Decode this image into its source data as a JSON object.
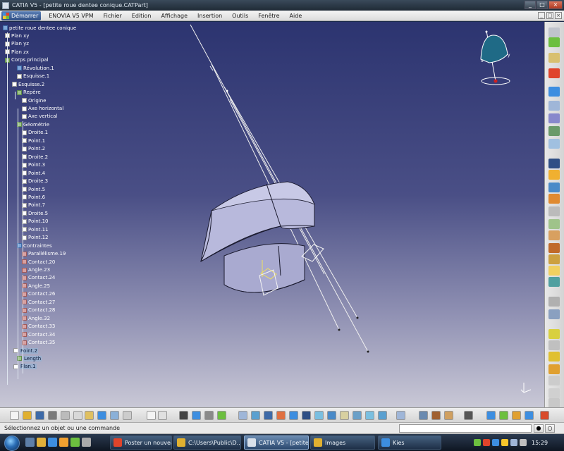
{
  "window": {
    "title": "CATIA V5 - [petite roue dentee conique.CATPart]",
    "controls": [
      "_",
      "□",
      "×"
    ]
  },
  "menu": {
    "start_label": "Démarrer",
    "items": [
      "ENOVIA V5 VPM",
      "Fichier",
      "Edition",
      "Affichage",
      "Insertion",
      "Outils",
      "Fenêtre",
      "Aide"
    ],
    "window_controls": [
      "_",
      "□",
      "×"
    ]
  },
  "tree": [
    {
      "label": "petite roue dentee conique",
      "icon": "part-icon"
    },
    {
      "label": "Plan xy",
      "icon": "plane-icon"
    },
    {
      "label": "Plan yz",
      "icon": "plane-icon"
    },
    {
      "label": "Plan zx",
      "icon": "plane-icon"
    },
    {
      "label": "Corps principal",
      "icon": "body-icon"
    },
    {
      "label": "Révolution.1",
      "icon": "revolution-icon"
    },
    {
      "label": "Esquisse.1",
      "icon": "sketch-icon"
    },
    {
      "label": "Esquisse.2",
      "icon": "sketch-icon"
    },
    {
      "label": "Repère",
      "icon": "axis-icon"
    },
    {
      "label": "Origine",
      "icon": "point-icon"
    },
    {
      "label": "Axe horizontal",
      "icon": "line-icon"
    },
    {
      "label": "Axe vertical",
      "icon": "line-icon"
    },
    {
      "label": "Géométrie",
      "icon": "geometry-icon"
    },
    {
      "label": "Droite.1",
      "icon": "line-icon"
    },
    {
      "label": "Point.1",
      "icon": "point-icon"
    },
    {
      "label": "Point.2",
      "icon": "point-icon"
    },
    {
      "label": "Droite.2",
      "icon": "line-icon"
    },
    {
      "label": "Point.3",
      "icon": "point-icon"
    },
    {
      "label": "Point.4",
      "icon": "point-icon"
    },
    {
      "label": "Droite.3",
      "icon": "line-icon"
    },
    {
      "label": "Point.5",
      "icon": "point-icon"
    },
    {
      "label": "Point.6",
      "icon": "point-icon"
    },
    {
      "label": "Point.7",
      "icon": "point-icon"
    },
    {
      "label": "Droite.5",
      "icon": "line-icon"
    },
    {
      "label": "Point.10",
      "icon": "point-icon"
    },
    {
      "label": "Point.11",
      "icon": "point-icon"
    },
    {
      "label": "Point.12",
      "icon": "point-icon"
    },
    {
      "label": "Contraintes",
      "icon": "constraints-icon"
    },
    {
      "label": "Parallélisme.19",
      "icon": "constraint-icon"
    },
    {
      "label": "Contact.20",
      "icon": "constraint-icon"
    },
    {
      "label": "Angle.23",
      "icon": "constraint-icon"
    },
    {
      "label": "Contact.24",
      "icon": "constraint-icon"
    },
    {
      "label": "Angle.25",
      "icon": "constraint-icon"
    },
    {
      "label": "Contact.26",
      "icon": "constraint-icon"
    },
    {
      "label": "Contact.27",
      "icon": "constraint-icon"
    },
    {
      "label": "Contact.28",
      "icon": "constraint-icon"
    },
    {
      "label": "Angle.32",
      "icon": "constraint-icon"
    },
    {
      "label": "Contact.33",
      "icon": "constraint-icon"
    },
    {
      "label": "Contact.34",
      "icon": "constraint-icon"
    },
    {
      "label": "Contact.35",
      "icon": "constraint-icon"
    },
    {
      "label": "Point.2",
      "icon": "point-icon"
    },
    {
      "label": "Length",
      "icon": "parameter-icon"
    },
    {
      "label": "Plan.1",
      "icon": "plane-icon"
    }
  ],
  "compass_labels": {
    "x": "x",
    "y": "y"
  },
  "status": {
    "message": "Sélectionnez un objet ou une commande",
    "command_value": ""
  },
  "taskbar": {
    "tasks": [
      {
        "label": "Poster un nouveau...",
        "icon": "chrome-icon"
      },
      {
        "label": "C:\\Users\\Public\\D...",
        "icon": "folder-icon"
      },
      {
        "label": "CATIA V5 - [petite ...",
        "icon": "catia-icon"
      },
      {
        "label": "Images",
        "icon": "folder-icon"
      },
      {
        "label": "Kies",
        "icon": "kies-icon"
      }
    ],
    "clock": "15:29"
  },
  "colors": {
    "accent": "#2f4f85",
    "viewport_top": "#2c3470",
    "viewport_bottom": "#c9c8d6",
    "part_fill": "#b8b9dc"
  }
}
